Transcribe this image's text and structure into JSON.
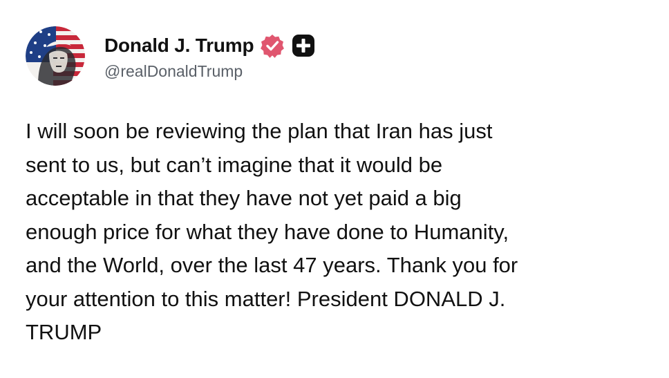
{
  "post": {
    "author": {
      "display_name": "Donald J. Trump",
      "handle": "@realDonaldTrump",
      "avatar_icon": "flag-portrait-avatar",
      "verified_icon": "verified-badge-icon",
      "follow_icon": "follow-plus-icon"
    },
    "text": "I will soon be reviewing the plan that Iran has just\nsent to us, but can’t imagine that it would be\nacceptable in that they have not yet paid a big\nenough price for what they have done to Humanity,\nand the World, over the last 47 years. Thank you for\nyour attention to this matter! President DONALD J.\nTRUMP"
  },
  "colors": {
    "verified_badge": "#e0566f",
    "follow_button": "#111111",
    "handle_text": "#5a6068"
  }
}
